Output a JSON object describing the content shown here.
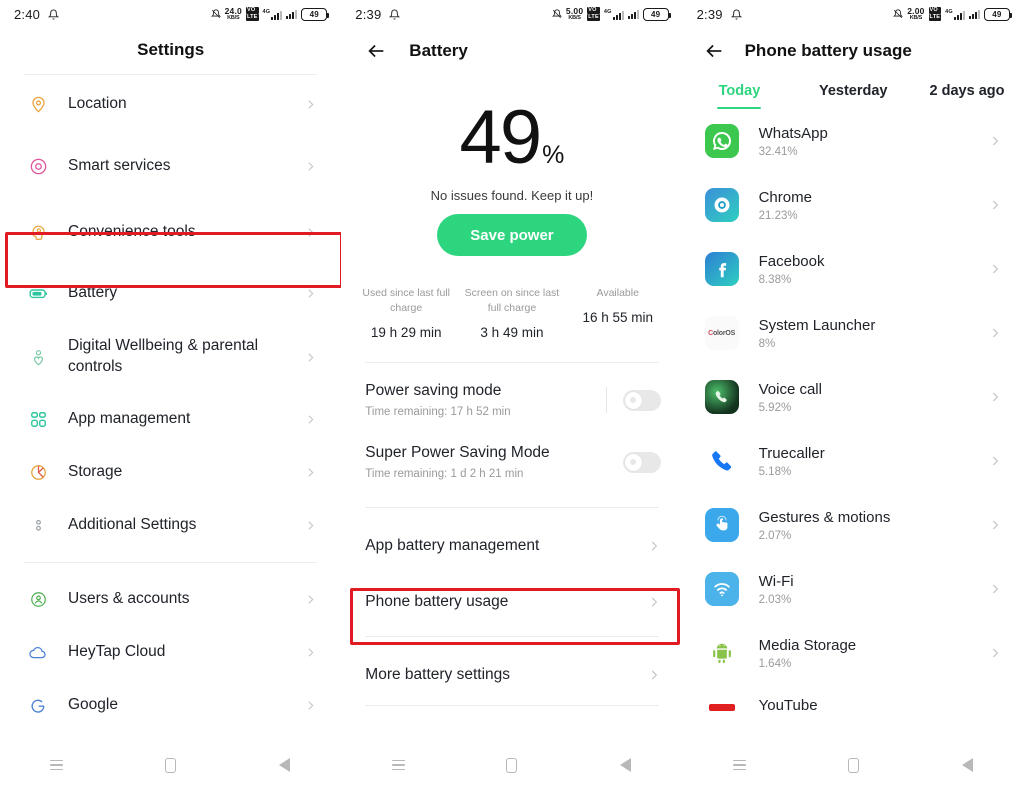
{
  "colors": {
    "accent_green": "#2ed57f",
    "highlight_red": "#e01b24",
    "text_primary": "#20232a",
    "text_secondary": "#9a9a9a"
  },
  "panel_settings": {
    "status": {
      "time": "2:40",
      "net_speed_value": "24.0",
      "net_speed_unit": "KB/S",
      "volte_top": "VO",
      "volte_bottom": "LTE",
      "network_label": "4G",
      "battery_level": "49"
    },
    "header": {
      "title": "Settings"
    },
    "items": [
      {
        "label": "Location",
        "icon": "location-pin-icon",
        "color": "#e8a33d"
      },
      {
        "label": "Smart services",
        "icon": "smart-services-icon",
        "color": "#e0519c"
      },
      {
        "label": "Convenience tools",
        "icon": "convenience-tools-icon",
        "color": "#e8a33d"
      },
      {
        "label": "Battery",
        "icon": "battery-icon",
        "color": "#2ec6a0",
        "highlighted": true
      },
      {
        "label": "Digital Wellbeing & parental controls",
        "icon": "wellbeing-heart-icon",
        "color": "#7ac9a4"
      },
      {
        "label": "App management",
        "icon": "app-management-icon",
        "color": "#2ec6a0"
      },
      {
        "label": "Storage",
        "icon": "storage-pie-icon",
        "color": "#e8a33d"
      },
      {
        "label": "Additional Settings",
        "icon": "additional-settings-icon",
        "color": "#9aa0a6"
      },
      {
        "label": "Users & accounts",
        "icon": "users-accounts-icon",
        "color": "#4caf50"
      },
      {
        "label": "HeyTap Cloud",
        "icon": "cloud-icon",
        "color": "#4a7fd4"
      },
      {
        "label": "Google",
        "icon": "google-g-icon",
        "color": "#4a7fd4"
      }
    ]
  },
  "panel_battery": {
    "status": {
      "time": "2:39",
      "net_speed_value": "5.00",
      "net_speed_unit": "KB/S",
      "volte_top": "VO",
      "volte_bottom": "LTE",
      "network_label": "4G",
      "battery_level": "49"
    },
    "header": {
      "title": "Battery",
      "back_icon": "back-arrow-icon"
    },
    "percent_number": "49",
    "percent_symbol": "%",
    "status_message": "No issues found. Keep it up!",
    "save_power_label": "Save power",
    "stats": [
      {
        "caption": "Used since last full charge",
        "value": "19 h 29 min"
      },
      {
        "caption": "Screen on since last full charge",
        "value": "3 h 49 min"
      },
      {
        "caption": "Available",
        "value": "16 h 55 min"
      }
    ],
    "power_modes": [
      {
        "title": "Power saving mode",
        "subtitle": "Time remaining:  17 h 52 min",
        "enabled": false
      },
      {
        "title": "Super Power Saving Mode",
        "subtitle": "Time remaining:  1 d 2 h 21 min",
        "enabled": false
      }
    ],
    "links": [
      {
        "label": "App battery management",
        "highlighted": false
      },
      {
        "label": "Phone battery usage",
        "highlighted": true
      },
      {
        "label": "More battery settings",
        "highlighted": false
      }
    ]
  },
  "panel_usage": {
    "status": {
      "time": "2:39",
      "net_speed_value": "2.00",
      "net_speed_unit": "KB/S",
      "volte_top": "VO",
      "volte_bottom": "LTE",
      "network_label": "4G",
      "battery_level": "49"
    },
    "header": {
      "title": "Phone battery usage",
      "back_icon": "back-arrow-icon"
    },
    "tabs": [
      {
        "label": "Today",
        "active": true
      },
      {
        "label": "Yesterday",
        "active": false
      },
      {
        "label": "2 days ago",
        "active": false
      }
    ],
    "apps": [
      {
        "name": "WhatsApp",
        "percent": "32.41%",
        "icon": "whatsapp-icon"
      },
      {
        "name": "Chrome",
        "percent": "21.23%",
        "icon": "chrome-icon"
      },
      {
        "name": "Facebook",
        "percent": "8.38%",
        "icon": "facebook-icon"
      },
      {
        "name": "System Launcher",
        "percent": "8%",
        "icon": "coloros-launcher-icon"
      },
      {
        "name": "Voice call",
        "percent": "5.92%",
        "icon": "voice-call-icon"
      },
      {
        "name": "Truecaller",
        "percent": "5.18%",
        "icon": "truecaller-icon"
      },
      {
        "name": "Gestures & motions",
        "percent": "2.07%",
        "icon": "gestures-motions-icon"
      },
      {
        "name": "Wi-Fi",
        "percent": "2.03%",
        "icon": "wifi-icon"
      },
      {
        "name": "Media Storage",
        "percent": "1.64%",
        "icon": "media-storage-android-icon"
      },
      {
        "name": "YouTube",
        "percent": "",
        "icon": "youtube-icon"
      }
    ]
  },
  "navbar": {
    "recents_label": "Recents",
    "home_label": "Home",
    "back_label": "Back"
  }
}
